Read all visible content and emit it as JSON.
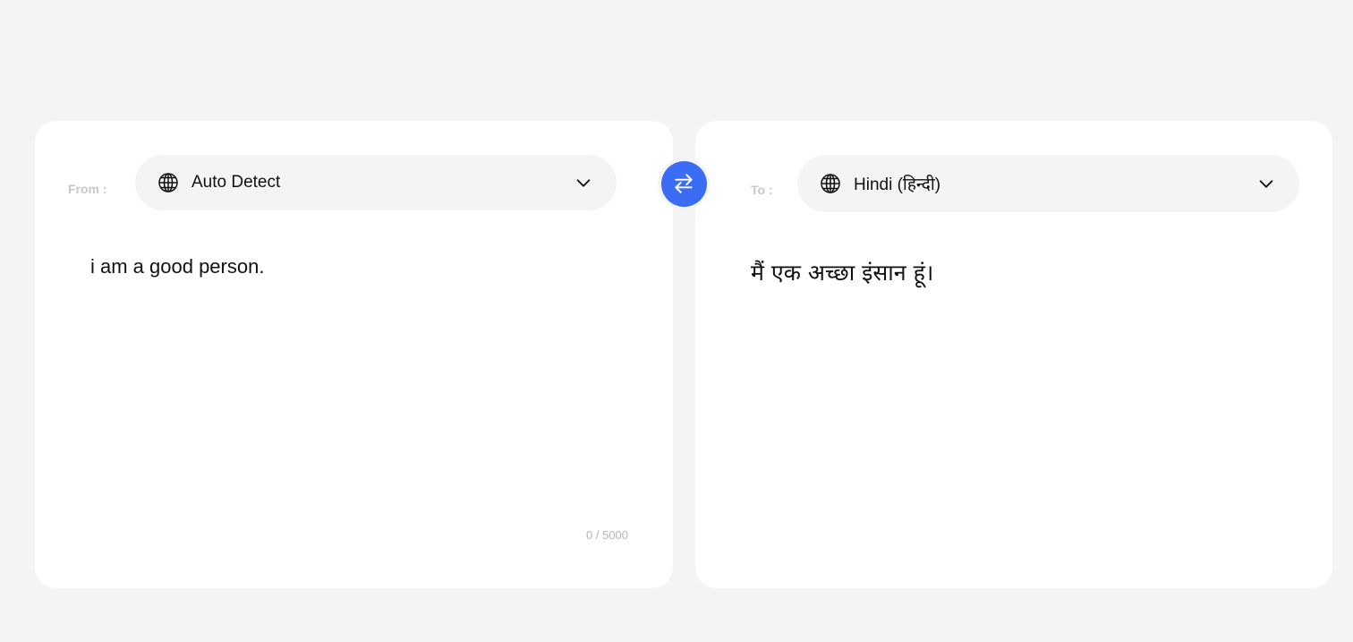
{
  "source_panel": {
    "label": "From :",
    "language": "Auto Detect",
    "text": "i am a good person.",
    "counter": "0 / 5000",
    "icons": {
      "language": "globe-icon",
      "dropdown": "chevron-down-icon"
    }
  },
  "target_panel": {
    "label": "To :",
    "language": "Hindi (हिन्दी)",
    "text": "मैं एक अच्छा इंसान हूं।",
    "icons": {
      "language": "globe-icon",
      "dropdown": "chevron-down-icon"
    }
  },
  "swap": {
    "icon": "swap-arrows-icon"
  },
  "colors": {
    "background": "#f4f4f4",
    "panel": "#ffffff",
    "accent": "#3a6cf4",
    "label": "#c8c8c8",
    "counter": "#b4b4b4"
  }
}
